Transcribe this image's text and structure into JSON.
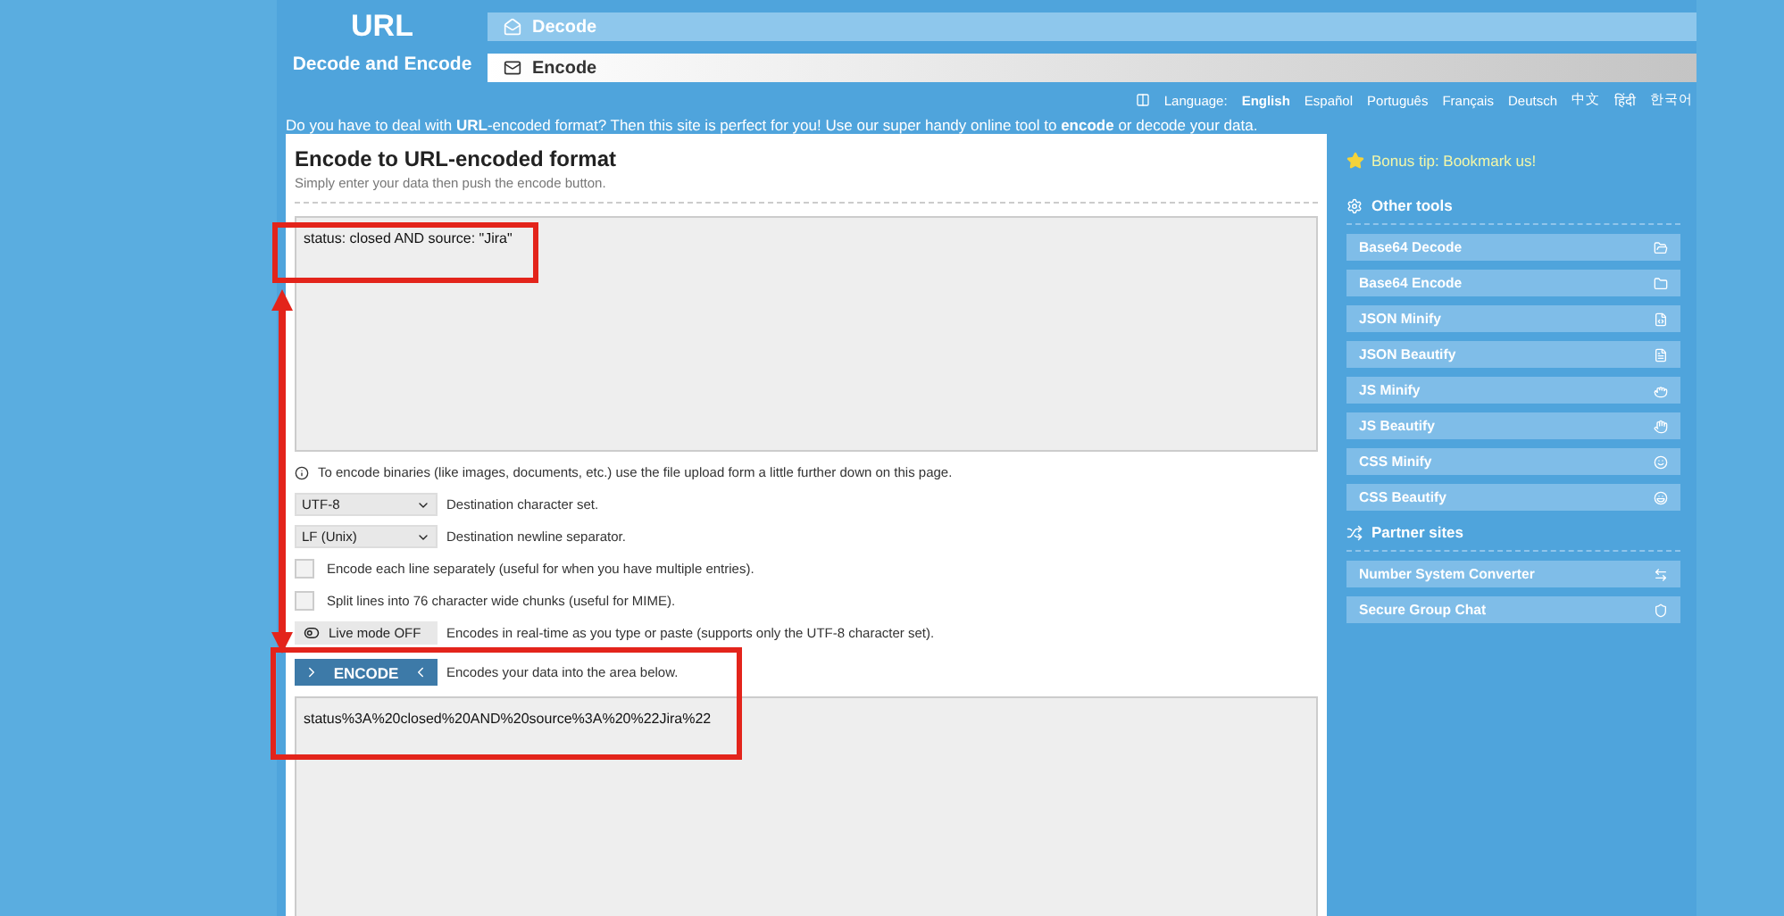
{
  "header": {
    "logo_title": "URL",
    "logo_subtitle": "Decode and Encode",
    "tabs": [
      {
        "label": "Decode",
        "selected": false
      },
      {
        "label": "Encode",
        "selected": true
      }
    ]
  },
  "languages": {
    "label": "Language:",
    "items": [
      {
        "label": "English",
        "selected": true
      },
      {
        "label": "Español",
        "selected": false
      },
      {
        "label": "Português",
        "selected": false
      },
      {
        "label": "Français",
        "selected": false
      },
      {
        "label": "Deutsch",
        "selected": false
      },
      {
        "label": "中文",
        "selected": false
      },
      {
        "label": "हिंदी",
        "selected": false
      },
      {
        "label": "한국어",
        "selected": false
      }
    ]
  },
  "intro": "Do you have to deal with **URL**-encoded format? Then this site is perfect for you! Use our super handy online tool to **encode** or decode your data.",
  "form": {
    "title": "Encode to URL-encoded format",
    "subtitle": "Simply enter your data then push the encode button.",
    "input": "status: closed AND source: \"Jira\"",
    "info": "To encode binaries (like images, documents, etc.) use the file upload form a little further down on this page.",
    "selects": [
      {
        "value": "UTF-8",
        "label": "Destination character set."
      },
      {
        "value": "LF (Unix)",
        "label": "Destination newline separator."
      }
    ],
    "checkboxes": [
      {
        "label": "Encode each line separately (useful for when you have multiple entries).",
        "checked": false
      },
      {
        "label": "Split lines into 76 character wide chunks (useful for MIME).",
        "checked": false
      }
    ],
    "live_mode": {
      "label": "Live mode",
      "state": "OFF",
      "on": false,
      "note": "Encodes in real-time as you type or paste (supports only the UTF-8 character set)."
    },
    "encode_button": {
      "label": "ENCODE",
      "note": "Encodes your data into the area below."
    },
    "output": "status%3A%20closed%20AND%20source%3A%20%22Jira%22"
  },
  "sidebar": {
    "tip": "Bonus tip: Bookmark us!",
    "sections": [
      {
        "title": "Other tools",
        "items": [
          "Base64 Decode",
          "Base64 Encode",
          "JSON Minify",
          "JSON Beautify",
          "JS Minify",
          "JS Beautify",
          "CSS Minify",
          "CSS Beautify"
        ]
      },
      {
        "title": "Partner sites",
        "items": [
          "Number System Converter",
          "Secure Group Chat"
        ]
      }
    ]
  }
}
